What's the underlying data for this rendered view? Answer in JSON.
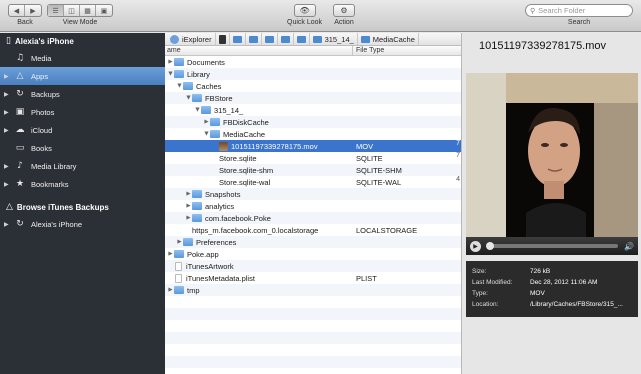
{
  "toolbar": {
    "back_label": "Back",
    "view_mode_label": "View Mode",
    "quick_look_label": "Quick Look",
    "action_label": "Action",
    "search_placeholder": "Search Folder",
    "search_label": "Search"
  },
  "sidebar": {
    "device": {
      "label": "Alexia's iPhone",
      "icon": "iphone-icon"
    },
    "items": [
      {
        "label": "Media",
        "icon": "music-app-icon",
        "expandable": false
      },
      {
        "label": "Apps",
        "icon": "apps-icon",
        "expandable": true,
        "selected": true
      },
      {
        "label": "Backups",
        "icon": "backup-icon",
        "expandable": true
      },
      {
        "label": "Photos",
        "icon": "camera-icon",
        "expandable": true
      },
      {
        "label": "iCloud",
        "icon": "cloud-icon",
        "expandable": true
      },
      {
        "label": "Books",
        "icon": "book-icon",
        "expandable": false
      },
      {
        "label": "Media Library",
        "icon": "music-note-icon",
        "expandable": true
      },
      {
        "label": "Bookmarks",
        "icon": "star-icon",
        "expandable": true
      }
    ],
    "itunes_header": "Browse iTunes Backups",
    "itunes_items": [
      {
        "label": "Alexia's iPhone",
        "icon": "backup-icon",
        "expandable": true
      }
    ]
  },
  "breadcrumb": {
    "items": [
      "iExplorer",
      "",
      "",
      "",
      "",
      "",
      "",
      "315_14_",
      "MediaCache"
    ]
  },
  "file_list": {
    "columns": {
      "name": "ame",
      "type": "File Type"
    },
    "rows": [
      {
        "name": "Documents",
        "type": "",
        "indent": 0,
        "kind": "folder",
        "expanded": false
      },
      {
        "name": "Library",
        "type": "",
        "indent": 0,
        "kind": "folder",
        "expanded": true
      },
      {
        "name": "Caches",
        "type": "",
        "indent": 1,
        "kind": "folder",
        "expanded": true
      },
      {
        "name": "FBStore",
        "type": "",
        "indent": 2,
        "kind": "folder",
        "expanded": true
      },
      {
        "name": "315_14_",
        "type": "",
        "indent": 3,
        "kind": "folder",
        "expanded": true
      },
      {
        "name": "FBDiskCache",
        "type": "",
        "indent": 4,
        "kind": "folder",
        "expanded": false
      },
      {
        "name": "MediaCache",
        "type": "",
        "indent": 4,
        "kind": "folder",
        "expanded": true
      },
      {
        "name": "10151197339278175.mov",
        "type": "MOV",
        "indent": 5,
        "kind": "movie",
        "selected": true,
        "edge": "7"
      },
      {
        "name": "Store.sqlite",
        "type": "SQLITE",
        "indent": 5,
        "kind": "none",
        "edge": "7"
      },
      {
        "name": "Store.sqlite-shm",
        "type": "SQLITE-SHM",
        "indent": 5,
        "kind": "none",
        "edge": ""
      },
      {
        "name": "Store.sqlite-wal",
        "type": "SQLITE-WAL",
        "indent": 5,
        "kind": "none",
        "edge": "4"
      },
      {
        "name": "Snapshots",
        "type": "",
        "indent": 2,
        "kind": "folder",
        "expanded": false
      },
      {
        "name": "analytics",
        "type": "",
        "indent": 2,
        "kind": "folder",
        "expanded": false
      },
      {
        "name": "com.facebook.Poke",
        "type": "",
        "indent": 2,
        "kind": "folder",
        "expanded": false
      },
      {
        "name": "https_m.facebook.com_0.localstorage",
        "type": "LOCALSTORAGE",
        "indent": 2,
        "kind": "none"
      },
      {
        "name": "Preferences",
        "type": "",
        "indent": 1,
        "kind": "folder",
        "expanded": false
      },
      {
        "name": "Poke.app",
        "type": "",
        "indent": 0,
        "kind": "folder",
        "expanded": false
      },
      {
        "name": "iTunesArtwork",
        "type": "",
        "indent": 0,
        "kind": "file"
      },
      {
        "name": "iTunesMetadata.plist",
        "type": "PLIST",
        "indent": 0,
        "kind": "file"
      },
      {
        "name": "tmp",
        "type": "",
        "indent": 0,
        "kind": "folder",
        "expanded": false
      },
      {
        "name": "",
        "type": "",
        "indent": 0,
        "kind": "empty"
      },
      {
        "name": "",
        "type": "",
        "indent": 0,
        "kind": "empty"
      },
      {
        "name": "",
        "type": "",
        "indent": 0,
        "kind": "empty"
      },
      {
        "name": "",
        "type": "",
        "indent": 0,
        "kind": "empty"
      },
      {
        "name": "",
        "type": "",
        "indent": 0,
        "kind": "empty"
      },
      {
        "name": "",
        "type": "",
        "indent": 0,
        "kind": "empty"
      }
    ]
  },
  "preview": {
    "title": "10151197339278175.mov",
    "playback_progress": 0.0,
    "info": [
      {
        "key": "Size:",
        "value": "726 kB"
      },
      {
        "key": "Last Modified:",
        "value": "Dec 28, 2012 11:06 AM"
      },
      {
        "key": "Type:",
        "value": "MOV"
      },
      {
        "key": "Location:",
        "value": "/Library/Caches/FBStore/315_..."
      }
    ]
  },
  "colors": {
    "sidebar_bg": "#2b2f36",
    "selection_blue": "#3a74cc",
    "folder_blue": "#5a98dd"
  }
}
